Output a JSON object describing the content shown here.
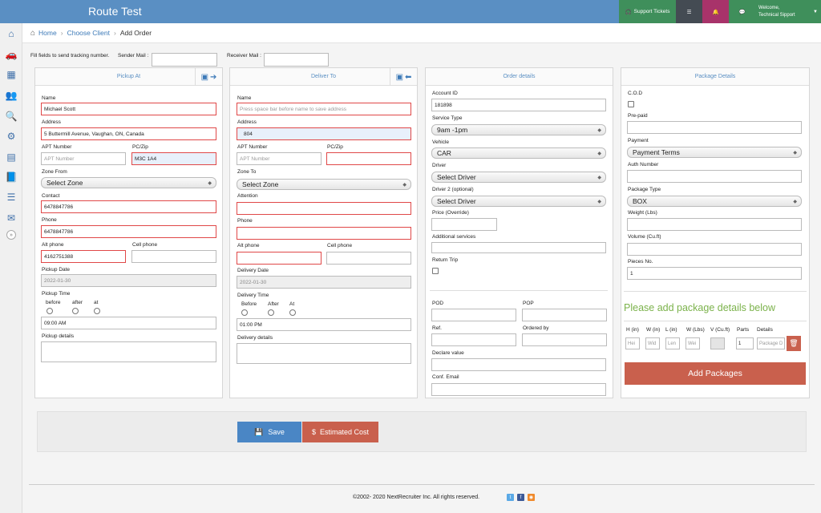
{
  "app": {
    "title": "Route Test"
  },
  "topbar": {
    "support_label": "Support Tickets",
    "welcome": "Welcome,",
    "user": "Technical Sipport",
    "colors": {
      "bar": "#5a8fc3",
      "green": "#3f8f5b",
      "dark": "#444b53",
      "magenta": "#a8336a"
    }
  },
  "sidebar": {
    "icons": [
      "home-icon",
      "car-icon",
      "calendar-icon",
      "users-icon",
      "search-icon",
      "gear-icon",
      "building-icon",
      "book-icon",
      "list-icon",
      "mail-icon"
    ],
    "collapse": "»"
  },
  "breadcrumb": {
    "home": "Home",
    "client": "Choose Client",
    "current": "Add Order",
    "sep": "›"
  },
  "tracking": {
    "instruction": "Fill fields to send tracking number.",
    "sender_label": "Sender Mail :",
    "receiver_label": "Receiver Mail :"
  },
  "pickup": {
    "title": "Pickup At",
    "name_label": "Name",
    "name": "Michael Scott",
    "address_label": "Address",
    "address": "5 Buttermill Avenue, Vaughan, ON, Canada",
    "apt_label": "APT Number",
    "apt_placeholder": "APT Number",
    "zip_label": "PC/Zip",
    "zip": "M3C 1A4",
    "zone_label": "Zone From",
    "zone": "Select Zone",
    "contact_label": "Contact",
    "contact": "6478847786",
    "phone_label": "Phone",
    "phone": "6478847786",
    "alt_label": "Alt phone",
    "alt": "4162751388",
    "cell_label": "Cell phone",
    "date_label": "Pickup Date",
    "date": "2022-01-30",
    "time_label": "Pickup Time",
    "time_opts": [
      "before",
      "after",
      "at"
    ],
    "time": "09:00 AM",
    "details_label": "Pickup details"
  },
  "deliver": {
    "title": "Deliver To",
    "name_label": "Name",
    "name_placeholder": "Press space bar before name to save address",
    "address_label": "Address",
    "address": "804",
    "apt_label": "APT Number",
    "apt_placeholder": "APT Number",
    "zip_label": "PC/Zip",
    "zone_label": "Zone To",
    "zone": "Select Zone",
    "attention_label": "Attention",
    "phone_label": "Phone",
    "alt_label": "Alt phone",
    "cell_label": "Cell phone",
    "date_label": "Delivery Date",
    "date": "2022-01-30",
    "time_label": "Delivery Time",
    "time_opts": [
      "Before",
      "After",
      "At"
    ],
    "time": "01:00 PM",
    "details_label": "Delivery details"
  },
  "order": {
    "title": "Order details",
    "account_label": "Account ID",
    "account": "181898",
    "service_label": "Service Type",
    "service": "9am -1pm",
    "vehicle_label": "Vehicle",
    "vehicle": "CAR",
    "driver_label": "Driver",
    "driver": "Select Driver",
    "driver2_label": "Driver 2 (optional)",
    "driver2": "Select Driver",
    "price_label": "Price (Override)",
    "additional_label": "Additional services",
    "return_label": "Return Trip",
    "pod_label": "POD",
    "pop_label": "POP",
    "ref_label": "Ref.",
    "ordered_label": "Ordered by",
    "declare_label": "Declare value",
    "conf_label": "Conf. Email"
  },
  "package": {
    "title": "Package Details",
    "cod_label": "C.O.D",
    "prepaid_label": "Pre-paid",
    "payment_label": "Payment",
    "payment": "Payment Terms",
    "auth_label": "Auth Number",
    "type_label": "Package Type",
    "type": "BOX",
    "weight_label": "Weight (Lbs)",
    "volume_label": "Volume (Cu.ft)",
    "pieces_label": "Pieces No.",
    "pieces": "1",
    "hint": "Please add package details below",
    "table_headers": [
      "H (in)",
      "W (in)",
      "L (in)",
      "W (Lbs)",
      "V (Cu.ft)",
      "Parts",
      "Details"
    ],
    "table_placeholders": [
      "Hei",
      "Wid",
      "Len",
      "Wei",
      "",
      "1",
      "Package D"
    ],
    "add_button": "Add Packages"
  },
  "actions": {
    "save": "Save",
    "cost": "Estimated Cost"
  },
  "footer": {
    "copyright": "©2002- 2020 NextRecruiter Inc. All rights reserved."
  }
}
